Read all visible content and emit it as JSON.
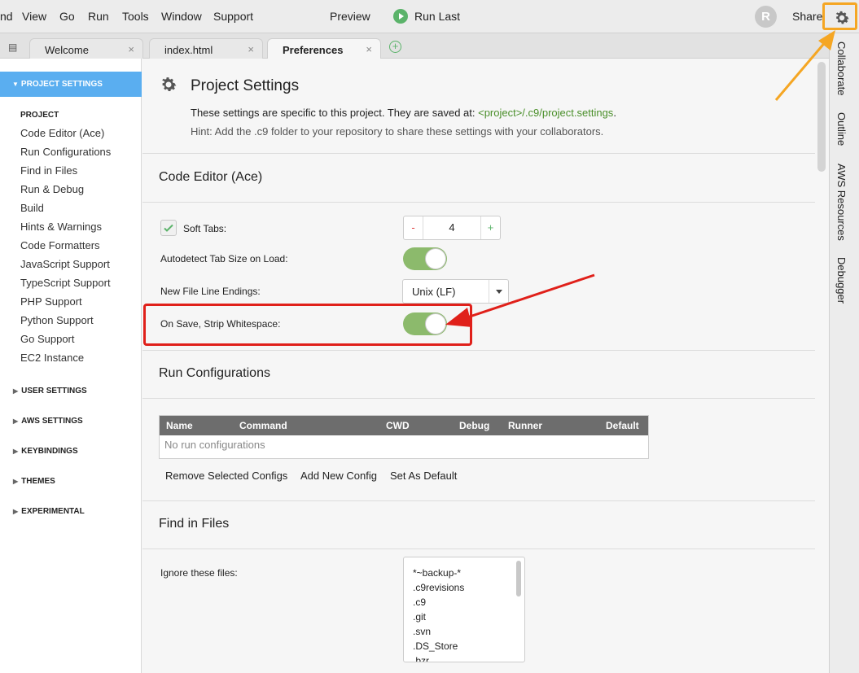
{
  "menubar": {
    "items": [
      "nd",
      "View",
      "Go",
      "Run",
      "Tools",
      "Window",
      "Support"
    ],
    "preview": "Preview",
    "run_last": "Run Last",
    "avatar_letter": "R",
    "share": "Share"
  },
  "tabs": [
    {
      "label": "Welcome"
    },
    {
      "label": "index.html"
    },
    {
      "label": "Preferences",
      "active": true
    }
  ],
  "tab_close": "×",
  "sidebar": {
    "active_group": "PROJECT SETTINGS",
    "project_label": "PROJECT",
    "links": [
      "Code Editor (Ace)",
      "Run Configurations",
      "Find in Files",
      "Run & Debug",
      "Build",
      "Hints & Warnings",
      "Code Formatters",
      "JavaScript Support",
      "TypeScript Support",
      "PHP Support",
      "Python Support",
      "Go Support",
      "EC2 Instance"
    ],
    "groups": [
      "USER SETTINGS",
      "AWS SETTINGS",
      "KEYBINDINGS",
      "THEMES",
      "EXPERIMENTAL"
    ]
  },
  "right_rail": [
    "Collaborate",
    "Outline",
    "AWS Resources",
    "Debugger"
  ],
  "main": {
    "title": "Project Settings",
    "desc_prefix": "These settings are specific to this project. They are saved at: ",
    "desc_path": "<project>/.c9/project.settings",
    "desc_suffix": ".",
    "hint": "Hint: Add the .c9 folder to your repository to share these settings with your collaborators.",
    "code_editor": {
      "title": "Code Editor (Ace)",
      "soft_tabs_label": "Soft Tabs:",
      "soft_tabs_checked": true,
      "tab_size": "4",
      "minus": "-",
      "plus": "+",
      "autodetect_label": "Autodetect Tab Size on Load:",
      "autodetect_on": true,
      "line_endings_label": "New File Line Endings:",
      "line_endings_value": "Unix (LF)",
      "strip_ws_label": "On Save, Strip Whitespace:",
      "strip_ws_on": true
    },
    "run_configs": {
      "title": "Run Configurations",
      "columns": [
        "Name",
        "Command",
        "CWD",
        "Debug",
        "Runner",
        "Default"
      ],
      "empty_text": "No run configurations",
      "buttons": [
        "Remove Selected Configs",
        "Add New Config",
        "Set As Default"
      ]
    },
    "find_in_files": {
      "title": "Find in Files",
      "ignore_label": "Ignore these files:",
      "ignore_list": [
        "*~backup-*",
        ".c9revisions",
        ".c9",
        ".git",
        ".svn",
        ".DS_Store",
        ".bzr"
      ]
    }
  },
  "colors": {
    "accent_blue": "#5aaef0",
    "toggle_green": "#8cba6c",
    "highlight_red": "#e0201a",
    "annotation_orange": "#f5a623"
  }
}
